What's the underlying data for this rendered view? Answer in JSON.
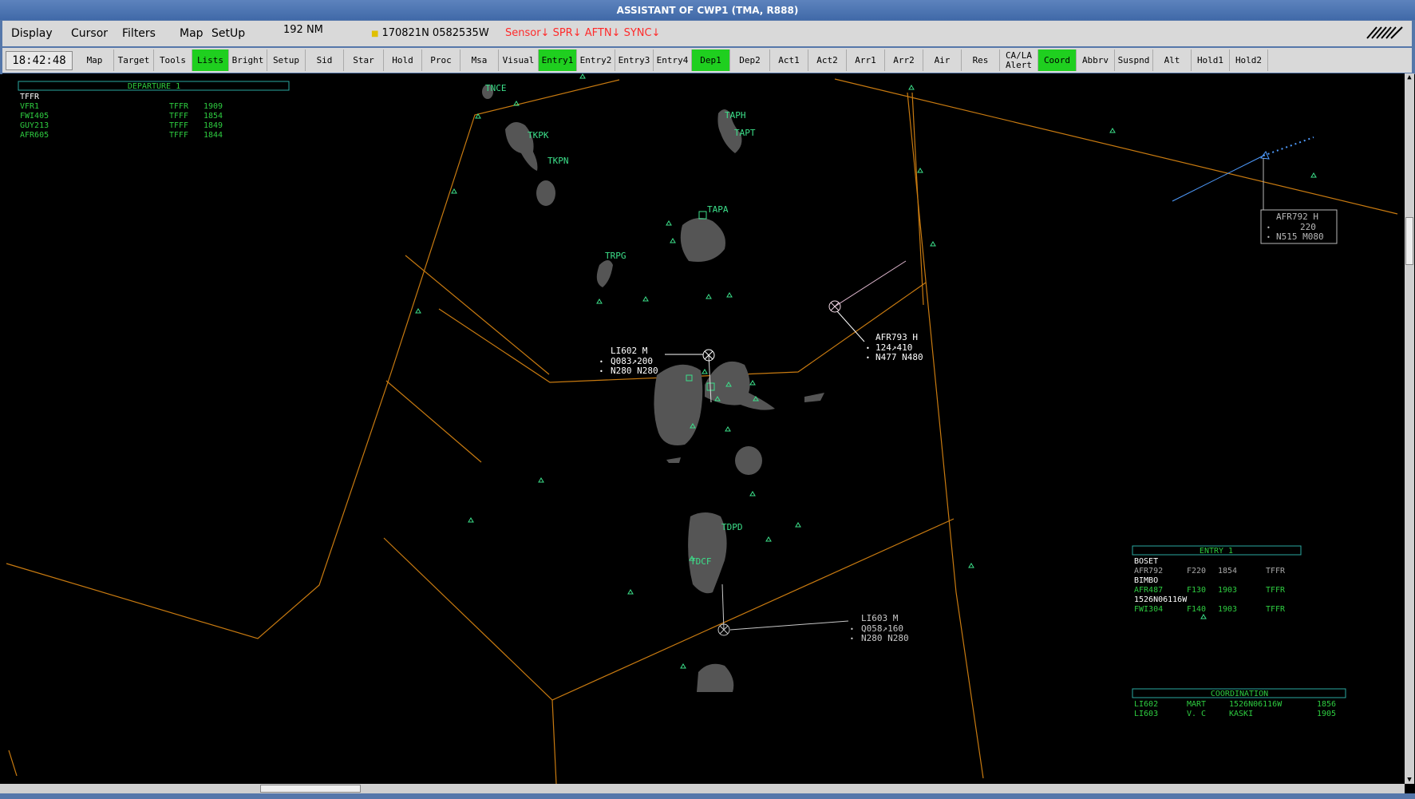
{
  "window": {
    "title": "ASSISTANT OF CWP1 (TMA, R888)"
  },
  "menu": {
    "items": [
      "Display",
      "Cursor",
      "Filters",
      "Map",
      "SetUp"
    ],
    "range": "192 NM",
    "cursor_position": "170821N 0582535W",
    "status_flags": "Sensor↓ SPR↓ AFTN↓ SYNC↓"
  },
  "toolbar": {
    "clock": "18:42:48",
    "buttons": [
      {
        "label": "Map",
        "active": false
      },
      {
        "label": "Target",
        "active": false
      },
      {
        "label": "Tools",
        "active": false
      },
      {
        "label": "Lists",
        "active": true
      },
      {
        "label": "Bright",
        "active": false
      },
      {
        "label": "Setup",
        "active": false
      },
      {
        "label": "Sid",
        "active": false
      },
      {
        "label": "Star",
        "active": false
      },
      {
        "label": "Hold",
        "active": false
      },
      {
        "label": "Proc",
        "active": false
      },
      {
        "label": "Msa",
        "active": false
      },
      {
        "label": "Visual",
        "active": false
      },
      {
        "label": "Entry1",
        "active": true
      },
      {
        "label": "Entry2",
        "active": false
      },
      {
        "label": "Entry3",
        "active": false
      },
      {
        "label": "Entry4",
        "active": false
      },
      {
        "label": "Dep1",
        "active": true
      },
      {
        "label": "Dep2",
        "active": false
      },
      {
        "label": "Act1",
        "active": false
      },
      {
        "label": "Act2",
        "active": false
      },
      {
        "label": "Arr1",
        "active": false
      },
      {
        "label": "Arr2",
        "active": false
      },
      {
        "label": "Air",
        "active": false
      },
      {
        "label": "Res",
        "active": false
      },
      {
        "label": "CA/LA Alert",
        "line1": "CA/LA",
        "line2": "Alert",
        "active": false
      },
      {
        "label": "Coord",
        "active": true
      },
      {
        "label": "Abbrv FP",
        "active": false
      },
      {
        "label": "Suspnd",
        "active": false
      },
      {
        "label": "Alt",
        "active": false
      },
      {
        "label": "Hold1",
        "active": false
      },
      {
        "label": "Hold2",
        "active": false
      }
    ]
  },
  "departure_list": {
    "title": "DEPARTURE 1",
    "airport": "TFFR",
    "rows": [
      {
        "callsign": "VFR1",
        "dest": "TFFR",
        "time": "1909"
      },
      {
        "callsign": "FWI405",
        "dest": "TFFF",
        "time": "1854"
      },
      {
        "callsign": "GUY213",
        "dest": "TFFF",
        "time": "1849"
      },
      {
        "callsign": "AFR605",
        "dest": "TFFF",
        "time": "1844"
      }
    ]
  },
  "entry_list": {
    "title": "ENTRY 1",
    "groups": [
      {
        "fix": "BOSET",
        "rows": [
          {
            "callsign": "AFR792",
            "level": "F220",
            "time": "1854",
            "dest": "TFFR",
            "dim": true
          }
        ]
      },
      {
        "fix": "BIMBO",
        "rows": [
          {
            "callsign": "AFR487",
            "level": "F130",
            "time": "1903",
            "dest": "TFFR",
            "dim": false
          }
        ]
      },
      {
        "fix": "1526N06116W",
        "rows": [
          {
            "callsign": "FWI304",
            "level": "F140",
            "time": "1903",
            "dest": "TFFR",
            "dim": false
          }
        ]
      }
    ]
  },
  "coordination_list": {
    "title": "COORDINATION",
    "rows": [
      {
        "callsign": "LI602",
        "from": "MART",
        "point": "1526N06116W",
        "time": "1856"
      },
      {
        "callsign": "LI603",
        "from": "V. C",
        "point": "KASKI",
        "time": "1905"
      }
    ]
  },
  "airports": [
    "TNCE",
    "TKPK",
    "TKPN",
    "TAPH",
    "TAPT",
    "TAPA",
    "TRPG",
    "TDPD",
    "TDCF"
  ],
  "tracks": [
    {
      "id": "AFR792",
      "line1": "AFR792 H",
      "line2": "220",
      "line3": "N515 M080",
      "color": "#b8b8b8"
    },
    {
      "id": "AFR793",
      "line1": "AFR793 H",
      "line2": "124↗410",
      "line3": "N477 N480",
      "color": "#ffffff"
    },
    {
      "id": "LI602",
      "line1": "LI602  M",
      "line2": "Q083↗200",
      "line3": "N280 N280",
      "color": "#ffffff"
    },
    {
      "id": "LI603",
      "line1": "LI603  M",
      "line2": "Q058↗160",
      "line3": "N280 N280",
      "color": "#c8c8c8"
    }
  ],
  "colors": {
    "sector_lines": "#c87a10",
    "map_labels": "#3ce08a",
    "active_button": "#1fcf1f",
    "status_alert": "#ff2a2a",
    "island": "#555555",
    "list_text": "#2ecc40",
    "list_border": "#2aa8a0"
  },
  "icons": {
    "fix_symbol": "triangle-icon",
    "track_symbol": "crossed-circle-icon",
    "airport_symbol": "square-icon"
  }
}
